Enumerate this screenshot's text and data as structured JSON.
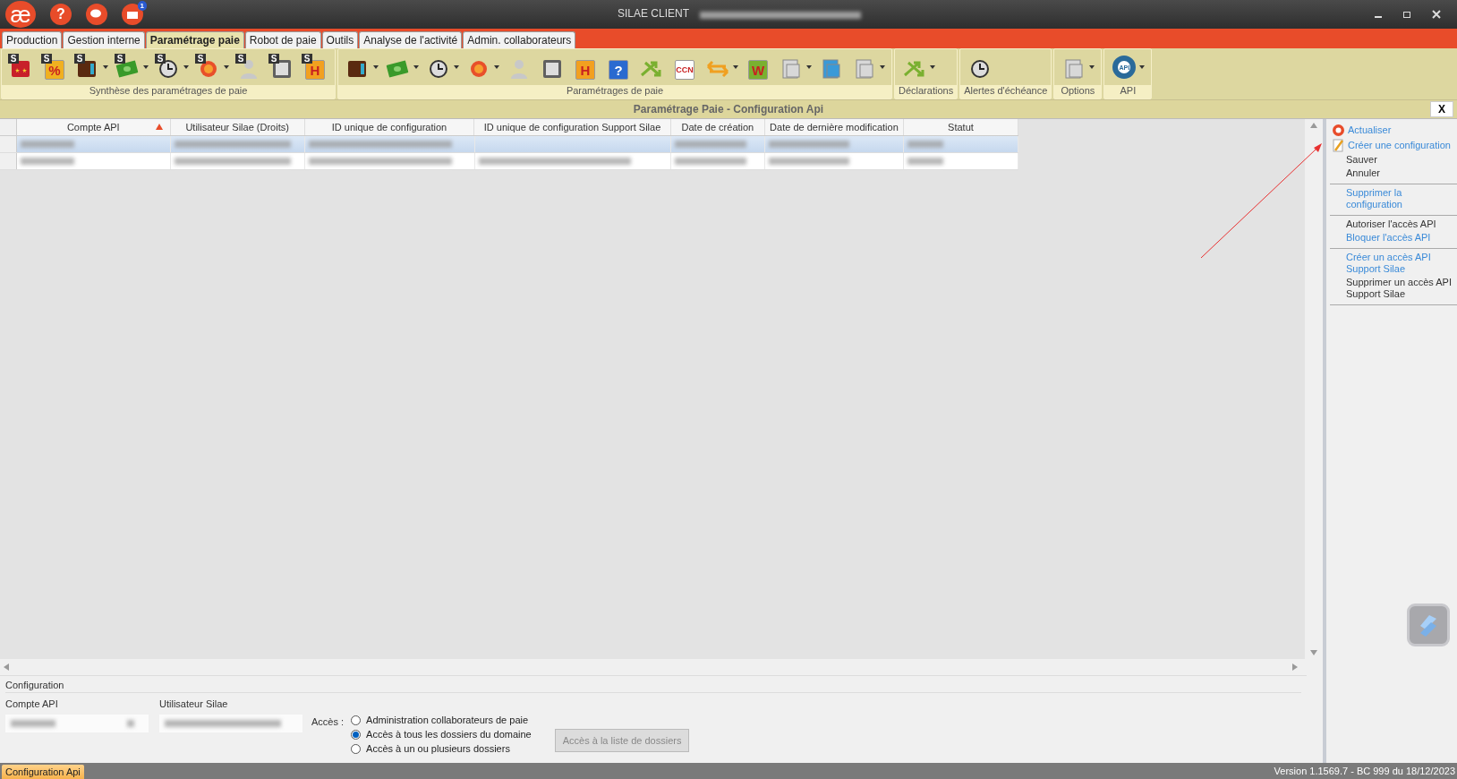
{
  "title_bar": {
    "logo": "æ",
    "buttons": [
      {
        "kind": "help",
        "glyph": "?"
      },
      {
        "kind": "chat"
      },
      {
        "kind": "mail",
        "badge": "1"
      }
    ],
    "title": "SILAE CLIENT"
  },
  "tabs": [
    {
      "label": "Production",
      "selected": false
    },
    {
      "label": "Gestion interne",
      "selected": false
    },
    {
      "label": "Paramétrage paie",
      "selected": true
    },
    {
      "label": "Robot de paie",
      "selected": false
    },
    {
      "label": "Outils",
      "selected": false
    },
    {
      "label": "Analyse de l'activité",
      "selected": false
    },
    {
      "label": "Admin. collaborateurs",
      "selected": false
    }
  ],
  "ribbon_groups": [
    {
      "label": "Synthèse des paramétrages de paie",
      "items": [
        {
          "kind": "tile",
          "badge": "S",
          "color": "#c8202a",
          "dropdown": false
        },
        {
          "kind": "glyph",
          "badge": "S",
          "glyph": "%",
          "color": "#f0b020",
          "dropdown": false
        },
        {
          "kind": "wallet",
          "badge": "S",
          "color": "#5a2a10",
          "dropdown": true
        },
        {
          "kind": "money",
          "badge": "S",
          "color": "#3a9a2a",
          "dropdown": true
        },
        {
          "kind": "clock",
          "badge": "S",
          "color": "#dddddd",
          "dropdown": true
        },
        {
          "kind": "coin",
          "badge": "S",
          "color": "#e8502a",
          "dropdown": true
        },
        {
          "kind": "person",
          "badge": "S",
          "color": "#c8c8c8",
          "dropdown": false
        },
        {
          "kind": "calc",
          "badge": "S",
          "color": "#606060",
          "dropdown": false
        },
        {
          "kind": "glyph",
          "badge": "S",
          "glyph": "H",
          "color": "#f2a020",
          "dropdown": false
        }
      ]
    },
    {
      "label": "Paramétrages de paie",
      "items": [
        {
          "kind": "wallet",
          "color": "#5a2a10",
          "dropdown": true
        },
        {
          "kind": "money",
          "color": "#3a9a2a",
          "dropdown": true
        },
        {
          "kind": "clock",
          "color": "#dddddd",
          "dropdown": true
        },
        {
          "kind": "coin",
          "color": "#e8502a",
          "dropdown": true
        },
        {
          "kind": "person",
          "color": "#c8c8c8",
          "dropdown": false
        },
        {
          "kind": "calc",
          "color": "#606060",
          "dropdown": false
        },
        {
          "kind": "glyph",
          "glyph": "H",
          "color": "#f2a020",
          "dropdown": false
        },
        {
          "kind": "glyph",
          "glyph": "?",
          "color": "#2a6ad0",
          "dropdown": false
        },
        {
          "kind": "arrows",
          "color": "#7ab030",
          "dropdown": false
        },
        {
          "kind": "glyph",
          "glyph": "CCN",
          "color": "#ffffff",
          "dropdown": false
        },
        {
          "kind": "swap",
          "color": "#f0a020",
          "dropdown": true
        },
        {
          "kind": "glyph",
          "glyph": "W",
          "color": "#7ab030",
          "dropdown": false
        },
        {
          "kind": "doc",
          "color": "#d8d8d8",
          "dropdown": true
        },
        {
          "kind": "doc",
          "color": "#3a9ad8",
          "dropdown": false
        },
        {
          "kind": "doc",
          "color": "#d8d8d8",
          "dropdown": true
        }
      ]
    },
    {
      "label": "Déclarations",
      "items": [
        {
          "kind": "arrows",
          "color": "#7ab030",
          "dropdown": true
        }
      ]
    },
    {
      "label": "Alertes d'échéance",
      "items": [
        {
          "kind": "clock",
          "color": "#dddddd",
          "dropdown": false
        }
      ]
    },
    {
      "label": "Options",
      "items": [
        {
          "kind": "doc",
          "color": "#d8d8d8",
          "dropdown": true
        }
      ]
    },
    {
      "label": "API",
      "items": [
        {
          "kind": "gear",
          "glyph": "API",
          "color": "#2a6a9a",
          "dropdown": true
        }
      ]
    }
  ],
  "panel": {
    "title": "Paramétrage Paie - Configuration Api",
    "close": "X"
  },
  "table": {
    "columns": [
      {
        "label": "Compte API",
        "sorted": true
      },
      {
        "label": "Utilisateur Silae (Droits)",
        "sorted": false
      },
      {
        "label": "ID unique de configuration",
        "sorted": false
      },
      {
        "label": "ID unique de configuration Support Silae",
        "sorted": false
      },
      {
        "label": "Date de création",
        "sorted": false
      },
      {
        "label": "Date de dernière modification",
        "sorted": false
      },
      {
        "label": "Statut",
        "sorted": false
      }
    ],
    "rows": [
      {
        "selected": true,
        "filled": [
          true,
          true,
          true,
          false,
          true,
          true,
          true
        ]
      },
      {
        "selected": false,
        "filled": [
          true,
          true,
          true,
          true,
          true,
          true,
          true
        ]
      }
    ]
  },
  "actions": [
    [
      {
        "label": "Actualiser",
        "disabled": false
      },
      {
        "label": "Créer une configuration",
        "disabled": false
      },
      {
        "label": "Sauver",
        "disabled": true
      },
      {
        "label": "Annuler",
        "disabled": true
      }
    ],
    [
      {
        "label": "Supprimer la configuration",
        "disabled": false
      }
    ],
    [
      {
        "label": "Autoriser l'accès API",
        "disabled": true
      },
      {
        "label": "Bloquer l'accès API",
        "disabled": false
      }
    ],
    [
      {
        "label": "Créer un accès API Support Silae",
        "disabled": false
      },
      {
        "label": "Supprimer un accès API Support Silae",
        "disabled": true
      }
    ]
  ],
  "configuration": {
    "legend": "Configuration",
    "account_label": "Compte API",
    "user_label": "Utilisateur Silae",
    "access_label": "Accès :",
    "access_options": [
      {
        "label": "Administration collaborateurs de paie",
        "selected": false
      },
      {
        "label": "Accès à tous les dossiers du domaine",
        "selected": true
      },
      {
        "label": "Accès à un ou plusieurs dossiers",
        "selected": false
      }
    ],
    "folders_button": {
      "label": "Accès à la liste de dossiers",
      "disabled": true
    }
  },
  "status_bar": {
    "tab": "Configuration Api",
    "version": "Version 1.1569.7 - BC 999 du 18/12/2023"
  }
}
